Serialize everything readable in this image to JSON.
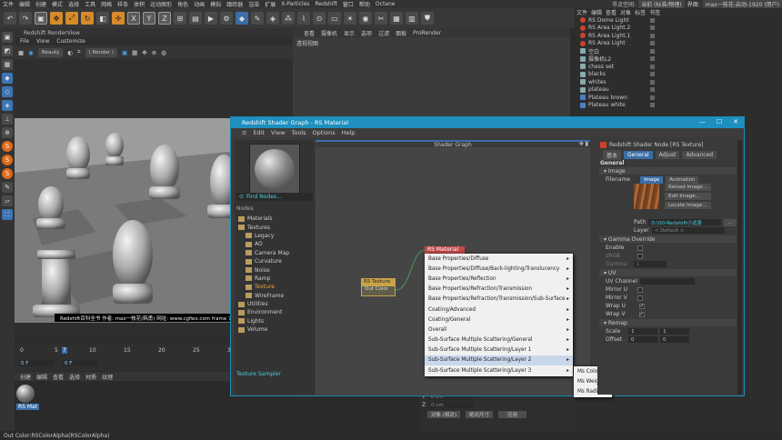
{
  "menubar": {
    "items": [
      "文件",
      "编辑",
      "创建",
      "模式",
      "选择",
      "工具",
      "网格",
      "样条",
      "体积",
      "运动图形",
      "角色",
      "动画",
      "模拟",
      "跟踪器",
      "渲染",
      "扩展",
      "X-Particles",
      "Redshift",
      "窗口",
      "帮助",
      "Octane"
    ],
    "layout_label": "节点空间:",
    "layout_value": "当前 (标准/物理)",
    "layout2_label": "界面:",
    "layout2_value": "max一枝花-启动-1920 (用户)"
  },
  "toolbar": {
    "axis_x": "X",
    "axis_y": "Y",
    "axis_z": "Z"
  },
  "render_view": {
    "title": "Redshift RenderView",
    "menu": [
      "File",
      "View",
      "Customize"
    ],
    "mode": "Beauty",
    "render_mode": "( Render )",
    "caption": "Redshift百科全书  作者: max一枝花(韩勇)  网址: www.cgfwx.com  frame 7:"
  },
  "viewport": {
    "menu": [
      "查看",
      "摄像机",
      "显示",
      "选项",
      "过滤",
      "面板",
      "ProRender"
    ],
    "label": "透视视图"
  },
  "object_manager": {
    "menu": [
      "文件",
      "编辑",
      "查看",
      "对象",
      "标签",
      "书签"
    ],
    "objects": [
      {
        "name": "RS Dome Light",
        "icon": "red"
      },
      {
        "name": "RS Area Light.2",
        "icon": "red"
      },
      {
        "name": "RS Area Light.1",
        "icon": "red"
      },
      {
        "name": "RS Area Light",
        "icon": "red"
      },
      {
        "name": "空白",
        "icon": "grey"
      },
      {
        "name": "摄像机L2",
        "icon": "grey"
      },
      {
        "name": "chess set",
        "icon": "grey"
      },
      {
        "name": "blacks",
        "icon": "grey"
      },
      {
        "name": "whites",
        "icon": "grey"
      },
      {
        "name": "plateau",
        "icon": "grey"
      },
      {
        "name": "Plateau brown",
        "icon": "blue"
      },
      {
        "name": "Plateau white",
        "icon": "blue"
      }
    ]
  },
  "timeline": {
    "ticks": [
      "0",
      "5",
      "10",
      "15",
      "20",
      "25",
      "30",
      "35"
    ],
    "current_frame": "7",
    "start_field": "0 F",
    "end_field": "0 F"
  },
  "material_manager": {
    "menu": [
      "创建",
      "编辑",
      "查看",
      "选择",
      "材质",
      "纹理"
    ],
    "material_name": "RS Mat"
  },
  "coords": {
    "y_label": "Y",
    "y_value": "0 cm",
    "z_label": "Z",
    "z_value": "0 cm",
    "mode": "对象 (相对)",
    "size_mode": "绝对尺寸",
    "apply": "应用"
  },
  "status": "Out Color:RSColorAlpha(RSColorAlpha)",
  "shader_graph": {
    "title": "Redshift Shader Graph - RS Material",
    "menu": [
      "Edit",
      "View",
      "Tools",
      "Options",
      "Help"
    ],
    "find_nodes": "Find Nodes...",
    "nodes_label": "Nodes",
    "tree": [
      {
        "label": "Materials",
        "indent": 0
      },
      {
        "label": "Textures",
        "indent": 0
      },
      {
        "label": "Legacy",
        "indent": 1
      },
      {
        "label": "AO",
        "indent": 1
      },
      {
        "label": "Camera Map",
        "indent": 1
      },
      {
        "label": "Curvature",
        "indent": 1
      },
      {
        "label": "Noise",
        "indent": 1
      },
      {
        "label": "Ramp",
        "indent": 1
      },
      {
        "label": "Texture",
        "indent": 1,
        "selected": true
      },
      {
        "label": "WireFrame",
        "indent": 1
      },
      {
        "label": "Utilities",
        "indent": 0
      },
      {
        "label": "Environment",
        "indent": 0
      },
      {
        "label": "Lights",
        "indent": 0
      },
      {
        "label": "Volume",
        "indent": 0
      }
    ],
    "texture_sampler": "Texture Sampler",
    "graph_title": "Shader Graph",
    "node_texture": {
      "title": "RS Texture",
      "port": "Out Color"
    },
    "node_material": {
      "title": "RS Material"
    },
    "context_menu": [
      "Base Properties/Diffuse",
      "Base Properties/Diffuse/Back-lighting/Translucency",
      "Base Properties/Reflection",
      "Base Properties/Refraction/Transmission",
      "Base Properties/Refraction/Transmission/Sub-Surface",
      "Coating/Advanced",
      "Coating/General",
      "Overall",
      "Sub-Surface Multiple Scattering/General",
      "Sub-Surface Multiple Scattering/Layer 1",
      "Sub-Surface Multiple Scattering/Layer 2",
      "Sub-Surface Multiple Scattering/Layer 3"
    ],
    "submenu": [
      "Ms Color 2",
      "Ms Weight 2",
      "Ms Radius 2"
    ],
    "attributes": {
      "title": "Redshift Shader Node [RS Texture]",
      "tabs": [
        "基本",
        "General",
        "Adjust",
        "Advanced"
      ],
      "section": "General",
      "image_group": "Image",
      "filename_label": "Filename",
      "image_tab": "Image",
      "animation_tab": "Animation",
      "reload": "Reload Image...",
      "edit": "Edit Image...",
      "locate": "Locate Image...",
      "path_label": "Path",
      "path_value": "D:\\00-Redshift小试身",
      "layer_label": "Layer",
      "layer_value": "< Default >",
      "gamma_group": "Gamma Override",
      "enable": "Enable",
      "srgb": "sRGB",
      "gamma": "Gamma",
      "gamma_value": "1",
      "uv_group": "UV",
      "uv_channel": "UV Channel",
      "mirror_u": "Mirror U",
      "mirror_v": "Mirror V",
      "wrap_u": "Wrap U",
      "wrap_v": "Wrap V",
      "remap_group": "Remap",
      "scale": "Scale",
      "scale_u": "1",
      "scale_v": "1",
      "offset": "Offset",
      "offset_u": "0",
      "offset_v": "0"
    }
  }
}
